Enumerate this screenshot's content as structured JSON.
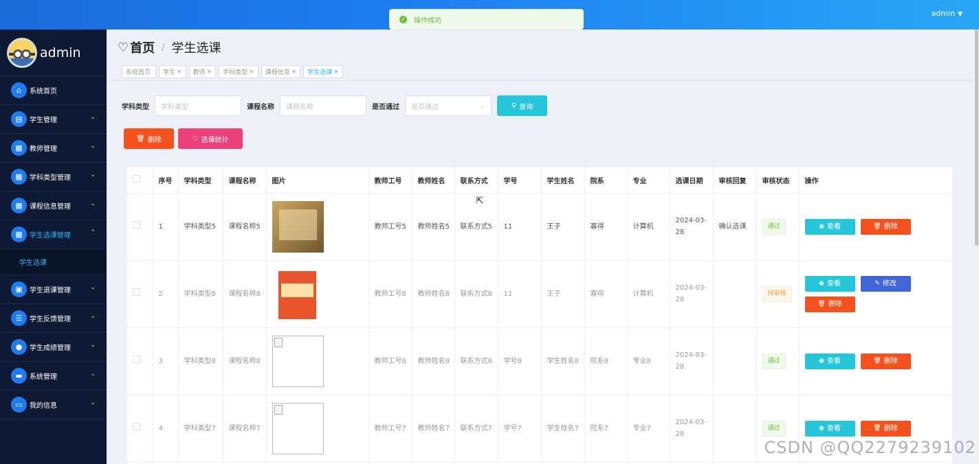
{
  "header": {
    "user": "admin",
    "caret": "▼"
  },
  "toast": {
    "message": "操作成功"
  },
  "sidebar": {
    "username": "admin",
    "items": [
      {
        "label": "系统首页",
        "icon": "home-icon",
        "glyph": "⌂",
        "chev": ""
      },
      {
        "label": "学生管理",
        "icon": "clipboard-icon",
        "glyph": "▤",
        "chev": "⌄"
      },
      {
        "label": "教师管理",
        "icon": "grid-icon",
        "glyph": "▦",
        "chev": "⌄"
      },
      {
        "label": "学科类型管理",
        "icon": "grid-icon",
        "glyph": "▦",
        "chev": "⌄"
      },
      {
        "label": "课程信息管理",
        "icon": "grid-icon",
        "glyph": "▦",
        "chev": "⌄"
      },
      {
        "label": "学生选课管理",
        "icon": "grid-icon",
        "glyph": "▦",
        "chev": "⌃"
      },
      {
        "label": "学生退课管理",
        "icon": "ticket-icon",
        "glyph": "▣",
        "chev": "⌄"
      },
      {
        "label": "学生反馈管理",
        "icon": "list-icon",
        "glyph": "☰",
        "chev": "⌄"
      },
      {
        "label": "学生成绩管理",
        "icon": "user-icon",
        "glyph": "●",
        "chev": "⌄"
      },
      {
        "label": "系统管理",
        "icon": "monitor-icon",
        "glyph": "▬",
        "chev": "⌄"
      },
      {
        "label": "我的信息",
        "icon": "card-icon",
        "glyph": "▭",
        "chev": "⌄"
      }
    ],
    "sub_item": "学生选课"
  },
  "breadcrumb": {
    "heart": "♡",
    "home": "首页",
    "sep": "/",
    "current": "学生选课"
  },
  "tags": [
    {
      "label": "系统首页",
      "close": ""
    },
    {
      "label": "学生",
      "close": "×"
    },
    {
      "label": "教师",
      "close": "×"
    },
    {
      "label": "学科类型",
      "close": "×"
    },
    {
      "label": "课程信息",
      "close": "×"
    },
    {
      "label": "学生选课",
      "close": "×"
    }
  ],
  "search": {
    "subject_label": "学科类型",
    "subject_placeholder": "学科类型",
    "course_label": "课程名称",
    "course_placeholder": "课程名称",
    "pass_label": "是否通过",
    "pass_placeholder": "是否通过",
    "search_button": "查询"
  },
  "actions": {
    "delete": "删除",
    "stats": "选课统计"
  },
  "table": {
    "headers": [
      "",
      "序号",
      "学科类型",
      "课程名称",
      "图片",
      "教师工号",
      "教师姓名",
      "联系方式",
      "学号",
      "学生姓名",
      "院系",
      "专业",
      "选课日期",
      "审核回复",
      "审核状态",
      "操作"
    ],
    "rows": [
      {
        "no": "1",
        "subject": "学科类型5",
        "course": "课程名称5",
        "img": "book1",
        "tno": "教师工号5",
        "tname": "教师姓名5",
        "contact": "联系方式5",
        "sno": "11",
        "sname": "王子",
        "dept": "寡得",
        "major": "计算机",
        "date": "2024-03-28",
        "reply": "确认选课",
        "status": "通过",
        "status_type": "pass",
        "ops": [
          "查看",
          "删除"
        ]
      },
      {
        "no": "2",
        "subject": "学科类型8",
        "course": "课程名称8",
        "img": "book2",
        "tno": "教师工号8",
        "tname": "教师姓名8",
        "contact": "联系方式8",
        "sno": "11",
        "sname": "王子",
        "dept": "寡得",
        "major": "计算机",
        "date": "2024-03-28",
        "reply": "",
        "status": "待审核",
        "status_type": "wait",
        "ops": [
          "查看",
          "修改",
          "删除"
        ]
      },
      {
        "no": "3",
        "subject": "学科类型8",
        "course": "课程名称8",
        "img": "broken",
        "tno": "教师工号8",
        "tname": "教师姓名8",
        "contact": "联系方式8",
        "sno": "学号8",
        "sname": "学生姓名8",
        "dept": "院系8",
        "major": "专业8",
        "date": "2024-03-28",
        "reply": "",
        "status": "通过",
        "status_type": "pass",
        "ops": [
          "查看",
          "删除"
        ]
      },
      {
        "no": "4",
        "subject": "学科类型7",
        "course": "课程名称7",
        "img": "broken",
        "tno": "教师工号7",
        "tname": "教师姓名7",
        "contact": "联系方式7",
        "sno": "学号7",
        "sname": "学生姓名7",
        "dept": "院系7",
        "major": "专业7",
        "date": "2024-03-28",
        "reply": "",
        "status": "通过",
        "status_type": "pass",
        "ops": [
          "查看",
          "删除"
        ]
      }
    ]
  },
  "watermark": "CSDN @QQ2279239102",
  "colors": {
    "primary": "#1d7df0",
    "cyan": "#26c6da",
    "danger": "#f4511e",
    "pink": "#ec407a",
    "edit": "#3f65d6",
    "sidebar": "#0e1a33"
  }
}
